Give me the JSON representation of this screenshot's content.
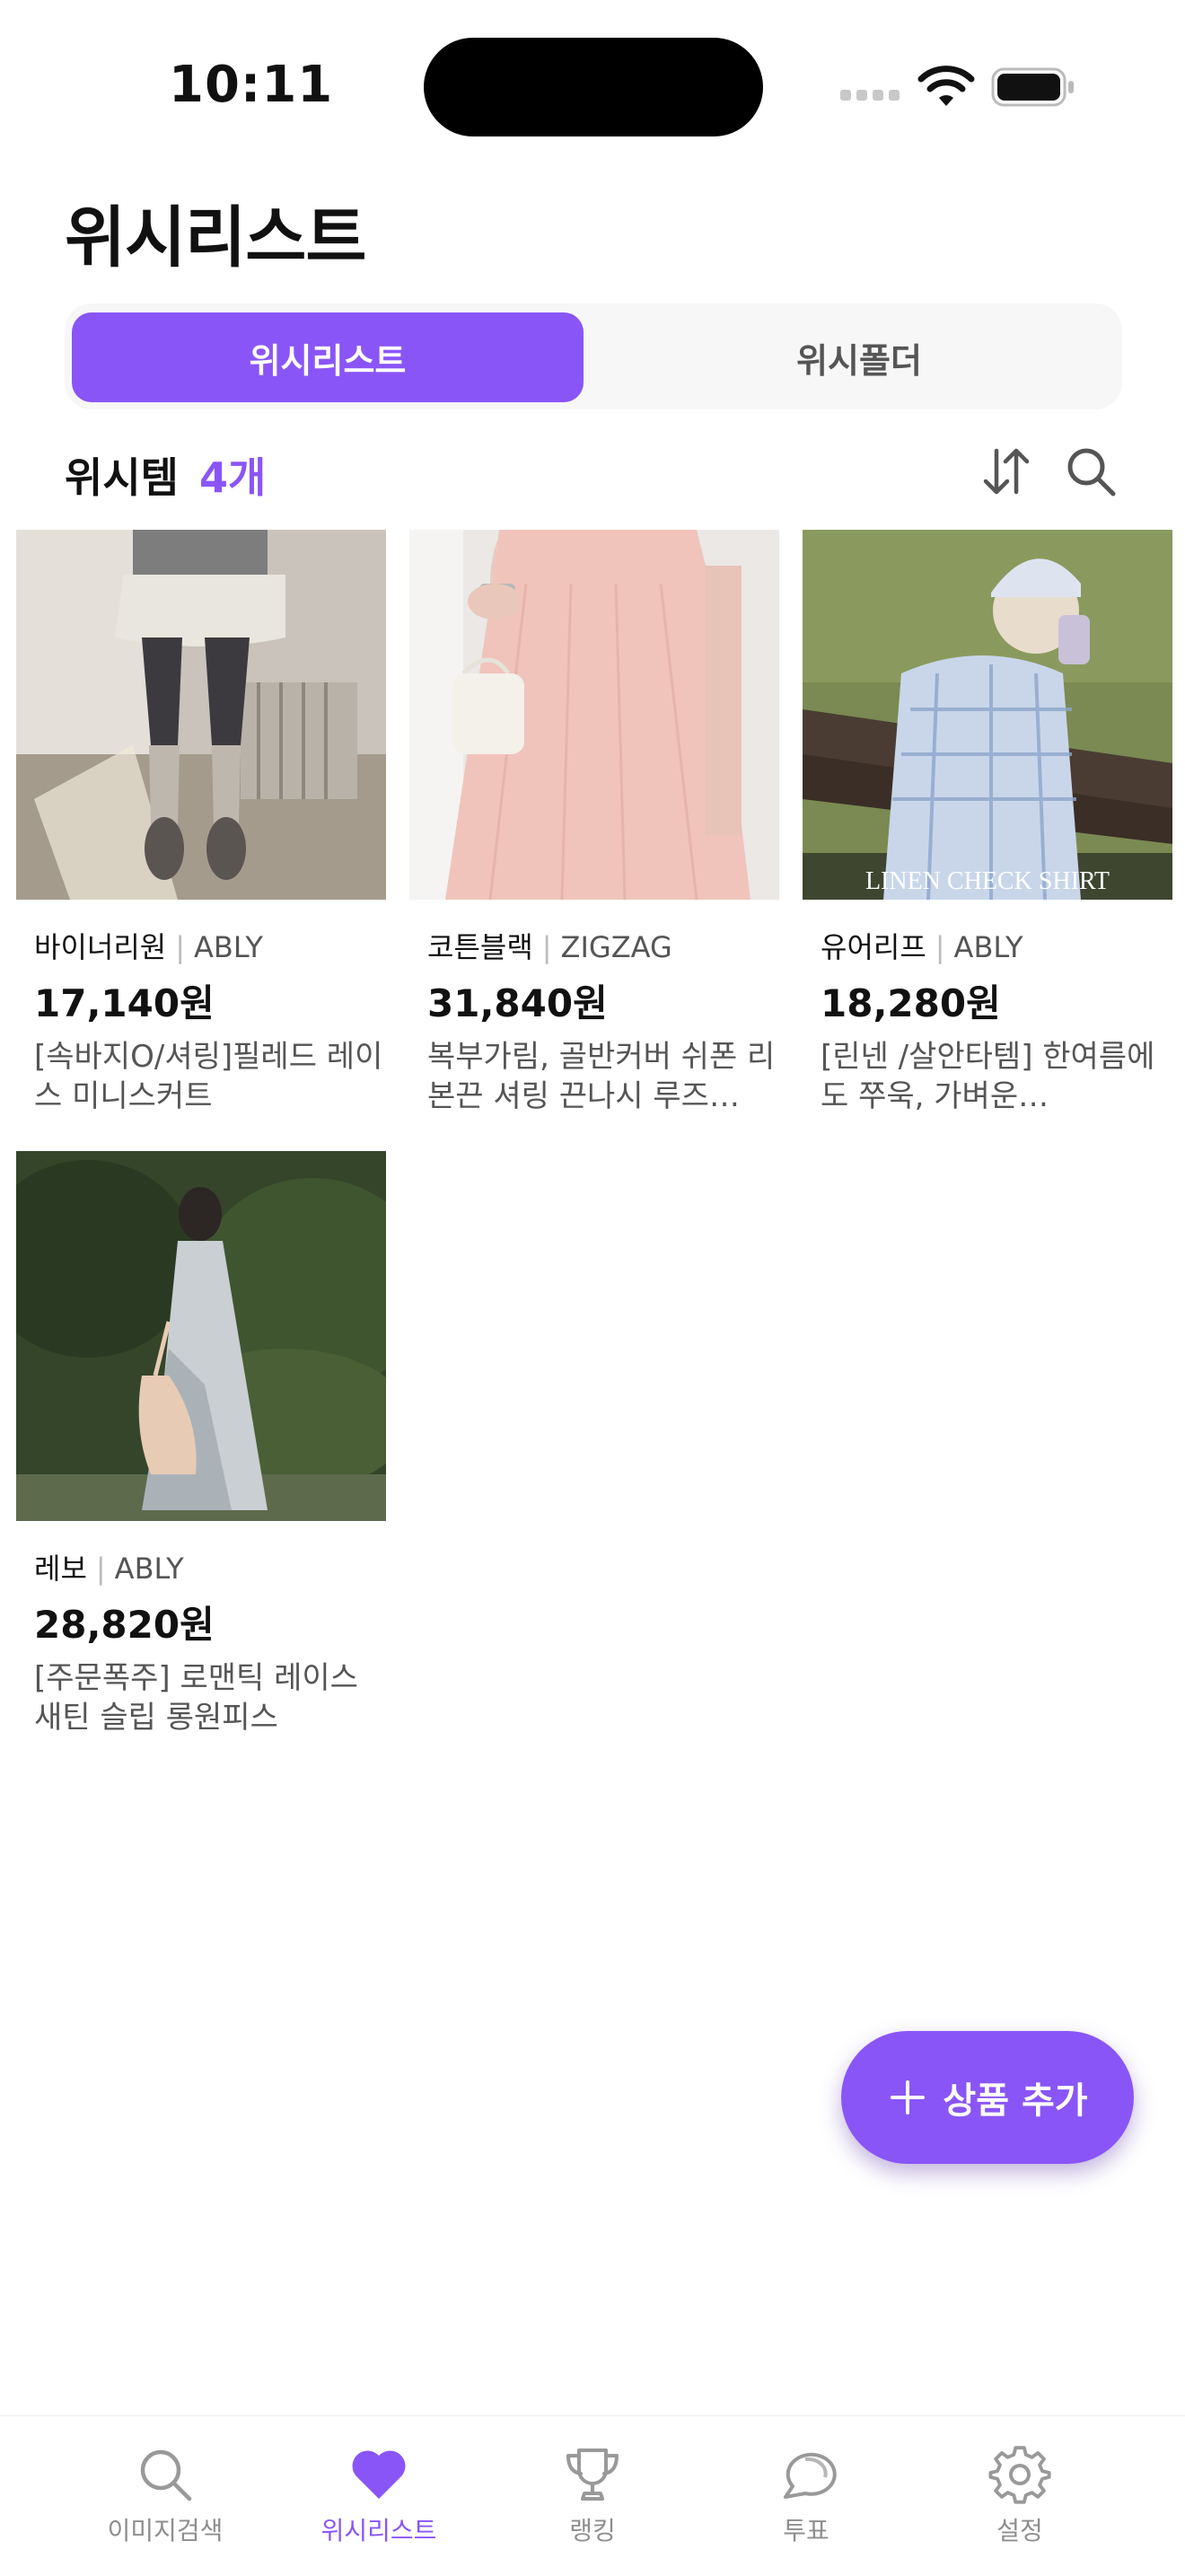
{
  "status_bar": {
    "time": "10:11"
  },
  "header": {
    "title": "위시리스트"
  },
  "segmented": {
    "active": "위시리스트",
    "inactive": "위시폴더"
  },
  "section": {
    "label": "위시템",
    "count": "4개"
  },
  "products": [
    {
      "store": "바이너리원",
      "platform": "ABLY",
      "price": "17,140원",
      "desc": "[속바지O/셔링]필레드 레이스 미니스커트"
    },
    {
      "store": "코튼블랙",
      "platform": "ZIGZAG",
      "price": "31,840원",
      "desc": "복부가림, 골반커버 쉬폰 리본끈 셔링 끈나시 루즈…"
    },
    {
      "store": "유어리프",
      "platform": "ABLY",
      "price": "18,280원",
      "desc": "[린넨￼ /살안타템] 한여름에도 쭈욱, 가벼운…",
      "image_text": "LINEN CHECK SHIRT"
    },
    {
      "store": "레보",
      "platform": "ABLY",
      "price": "28,820원",
      "desc": "[주문폭주] 로맨틱 레이스 새틴 슬립 롱원피스"
    }
  ],
  "fab": {
    "label": "상품 추가"
  },
  "tabbar": {
    "items": [
      {
        "label": "이미지검색",
        "icon": "search-icon"
      },
      {
        "label": "위시리스트",
        "icon": "heart-icon"
      },
      {
        "label": "랭킹",
        "icon": "trophy-icon"
      },
      {
        "label": "투표",
        "icon": "chat-bubble-icon"
      },
      {
        "label": "설정",
        "icon": "gear-icon"
      }
    ]
  },
  "colors": {
    "accent": "#8a55f7",
    "text": "#111111",
    "muted": "#555555"
  }
}
